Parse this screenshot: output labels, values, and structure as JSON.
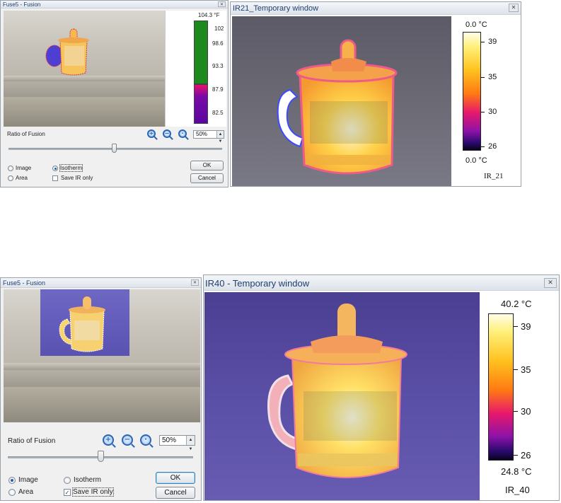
{
  "top": {
    "fusion_window": {
      "title": "Fuse5 - Fusion",
      "close_glyph": "✕",
      "scale": {
        "top_label": "104.3 °F",
        "ticks": [
          "102",
          "98.6",
          "93.3",
          "87.9",
          "82.5"
        ],
        "colors": {
          "upper": "#1e8a1e",
          "lower": "#7a0aa8"
        }
      },
      "ratio_label": "Ratio of Fusion",
      "zoom_value": "50%",
      "slider_fraction": 0.5,
      "radio_image": "Image",
      "radio_isotherm": "Isotherm",
      "radio_area": "Area",
      "selected_radio": "isotherm",
      "save_ir_label": "Save IR only",
      "save_ir_checked": false,
      "ok_label": "OK",
      "cancel_label": "Cancel"
    },
    "ir_window": {
      "title": "IR21_Temporary window",
      "close_glyph": "✕",
      "legend": {
        "max_label": "0.0 °C",
        "min_label": "0.0 °C",
        "ticks": [
          "39",
          "35",
          "30",
          "26"
        ],
        "caption": "IR_21"
      }
    }
  },
  "bottom": {
    "fusion_window": {
      "title": "Fuse5 - Fusion",
      "close_glyph": "✕",
      "ratio_label": "Ratio of Fusion",
      "zoom_value": "50%",
      "slider_fraction": 0.5,
      "radio_image": "Image",
      "radio_isotherm": "Isotherm",
      "radio_area": "Area",
      "selected_radio": "image",
      "save_ir_label": "Save IR only",
      "save_ir_checked": true,
      "check_glyph": "✓",
      "ok_label": "OK",
      "cancel_label": "Cancel"
    },
    "ir_window": {
      "title": "IR40 - Temporary window",
      "close_glyph": "✕",
      "legend": {
        "max_label": "40.2 °C",
        "min_label": "24.8 °C",
        "ticks": [
          "39",
          "35",
          "30",
          "26"
        ],
        "caption": "IR_40"
      }
    }
  },
  "zoom_icons": {
    "zoom_in": "+",
    "zoom_out": "−",
    "zoom_fit": "·"
  },
  "spin_glyphs": {
    "up": "▲",
    "down": "▼"
  }
}
